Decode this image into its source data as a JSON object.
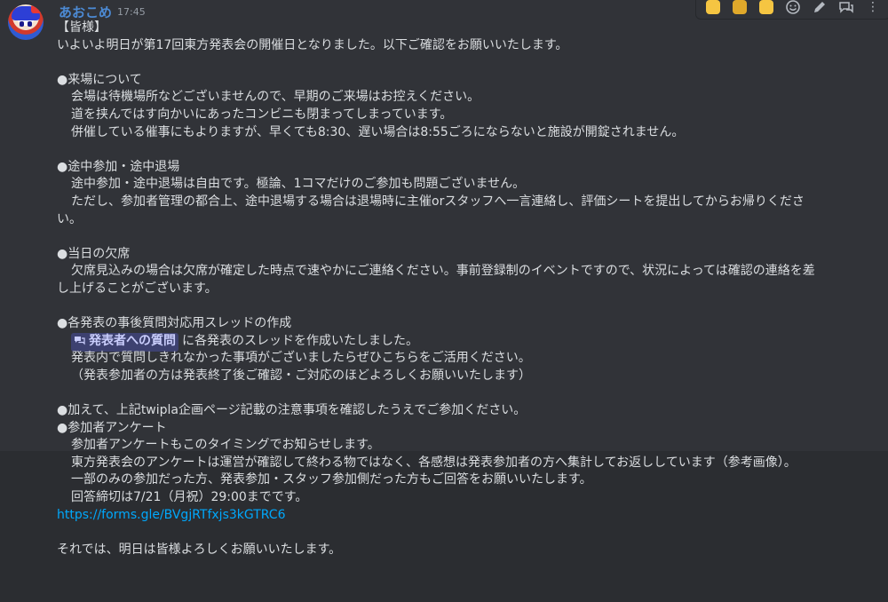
{
  "message": {
    "author": "あおこめ",
    "time": "17:45",
    "lines": {
      "greeting": "【皆様】",
      "intro": "いよいよ明日が第17回東方発表会の開催日となりました。以下ご確認をお願いいたします。",
      "s1_head": "●来場について",
      "s1_l1": "会場は待機場所などございませんので、早期のご来場はお控えください。",
      "s1_l2": "道を挟んではす向かいにあったコンビニも閉まってしまっています。",
      "s1_l3": "併催している催事にもよりますが、早くても8:30、遅い場合は8:55ごろにならないと施設が開錠されません。",
      "s2_head": "●途中参加・途中退場",
      "s2_l1": "途中参加・途中退場は自由です。極論、1コマだけのご参加も問題ございません。",
      "s2_l2": "ただし、参加者管理の都合上、途中退場する場合は退場時に主催orスタッフへ一言連絡し、評価シートを提出してからお帰りくださ",
      "s2_l3": "い。",
      "s3_head": "●当日の欠席",
      "s3_l1": "欠席見込みの場合は欠席が確定した時点で速やかにご連絡ください。事前登録制のイベントですので、状況によっては確認の連絡を差",
      "s3_l2": "し上げることがございます。",
      "s4_head": "●各発表の事後質問対応用スレッドの作成",
      "s4_mention": "発表者への質問",
      "s4_l1_rest": "に各発表のスレッドを作成いたしました。",
      "s4_l2": "発表内で質問しきれなかった事項がございましたらぜひこちらをご活用ください。",
      "s4_l3": "（発表参加者の方は発表終了後ご確認・ご対応のほどよろしくお願いいたします）",
      "s5_head": "●加えて、上記twipla企画ページ記載の注意事項を確認したうえでご参加ください。",
      "s6_head": "●参加者アンケート",
      "s6_l1": "参加者アンケートもこのタイミングでお知らせします。",
      "s6_l2": "東方発表会のアンケートは運営が確認して終わる物ではなく、各感想は発表参加者の方へ集計してお返ししています（参考画像）。",
      "s6_l3": "一部のみの参加だった方、発表参加・スタッフ参加側だった方もご回答をお願いいたします。",
      "s6_l4": "回答締切は7/21（月祝）29:00までです。",
      "link": "https://forms.gle/BVgjRTfxjs3kGTRC6",
      "closing": "それでは、明日は皆様よろしくお願いいたします。"
    }
  },
  "toolbar": {
    "icons": [
      "reaction-emoji-1",
      "reaction-emoji-2",
      "reaction-emoji-3",
      "add-reaction-icon",
      "edit-icon",
      "thread-icon",
      "more-icon"
    ],
    "more": "⋮"
  },
  "colors": {
    "background": "#313338",
    "username": "#4c8ad4",
    "link": "#00a8fc",
    "mention_bg": "#3c4270"
  }
}
